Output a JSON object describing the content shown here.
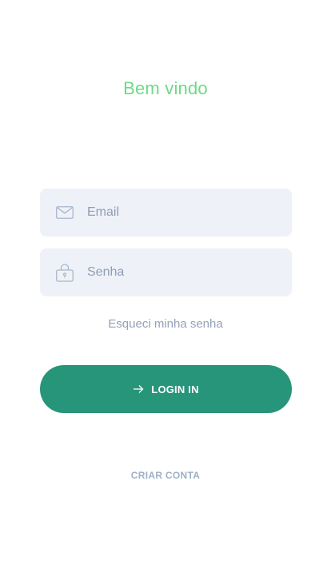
{
  "welcome": {
    "title": "Bem vindo"
  },
  "form": {
    "email": {
      "placeholder": "Email",
      "value": "",
      "icon": "envelope-icon"
    },
    "password": {
      "placeholder": "Senha",
      "value": "",
      "icon": "lock-icon"
    },
    "forgot_label": "Esqueci minha senha"
  },
  "login_button": {
    "label": "LOGIN IN",
    "icon": "arrow-right-icon"
  },
  "create_account_label": "CRIAR CONTA",
  "colors": {
    "title": "#6cdb83",
    "primary": "#27957a",
    "field_bg": "#eef1f7",
    "muted_text": "#93a2b8"
  }
}
